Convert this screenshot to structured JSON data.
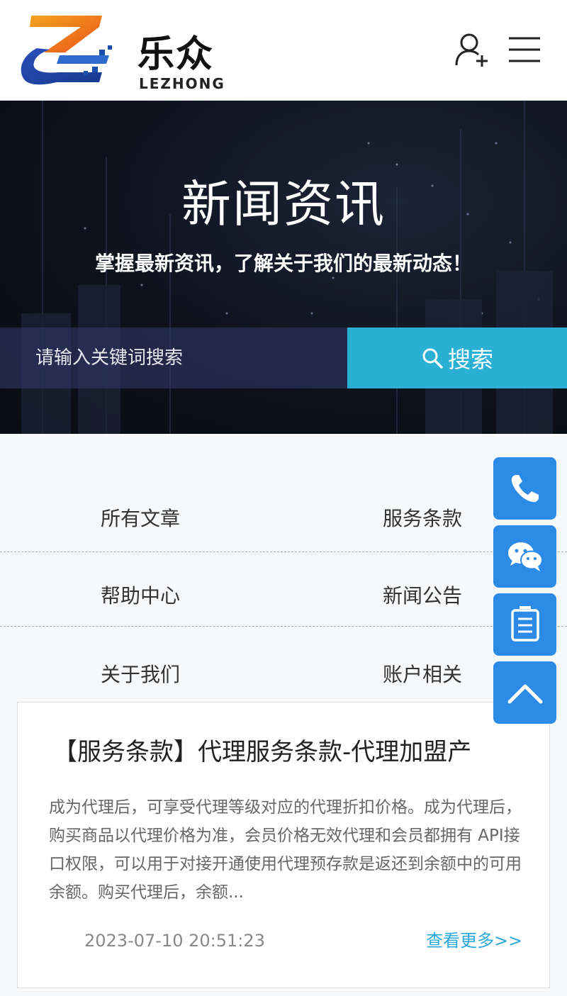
{
  "header": {
    "logo_cn": "乐众",
    "logo_en": "LEZHONG",
    "icons": {
      "user": "user-add-icon",
      "menu": "hamburger-menu-icon"
    }
  },
  "banner": {
    "title": "新闻资讯",
    "subtitle": "掌握最新资讯，了解关于我们的最新动态！",
    "search": {
      "placeholder": "请输入关键词搜索",
      "button_label": "搜索"
    }
  },
  "categories": [
    {
      "left": "所有文章",
      "right": "服务条款"
    },
    {
      "left": "帮助中心",
      "right": "新闻公告"
    },
    {
      "left": "关于我们",
      "right": "账户相关"
    }
  ],
  "article": {
    "title": "【服务条款】代理服务条款-代理加盟产",
    "excerpt": "成为代理后，可享受代理等级对应的代理折扣价格。成为代理后，购买商品以代理价格为准，会员价格无效代理和会员都拥有 API接口权限，可以用于对接开通使用代理预存款是返还到余额中的可用余额。购买代理后，余额...",
    "date": "2023-07-10 20:51:23",
    "more_label": "查看更多>>"
  },
  "float_buttons": [
    "phone-icon",
    "wechat-icon",
    "notepad-icon",
    "back-to-top-icon"
  ],
  "colors": {
    "search_button": "#29b0d4",
    "float_button": "#2d8be8",
    "more_link": "#2aa8dc",
    "banner_bg": "#0d121c"
  }
}
